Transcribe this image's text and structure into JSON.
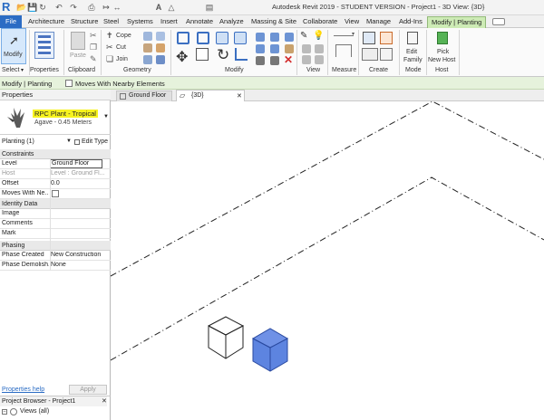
{
  "app": {
    "title": "Autodesk Revit 2019 - STUDENT VERSION - Project1 - 3D View: {3D}",
    "logo_letter": "R"
  },
  "tabs": [
    "File",
    "Architecture",
    "Structure",
    "Steel",
    "Systems",
    "Insert",
    "Annotate",
    "Analyze",
    "Massing & Site",
    "Collaborate",
    "View",
    "Manage",
    "Add-Ins",
    "Modify | Planting"
  ],
  "ribbon": {
    "modify_label": "Modify",
    "panels": {
      "select": "Select",
      "properties": "Properties",
      "clipboard": "Clipboard",
      "geometry": "Geometry",
      "modify": "Modify",
      "view": "View",
      "measure": "Measure",
      "create": "Create",
      "mode": "Mode",
      "host": "Host"
    },
    "clipboard": {
      "paste": "Paste"
    },
    "geometry": {
      "cope": "Cope",
      "cut": "Cut",
      "join": "Join"
    },
    "mode": {
      "edit_family_1": "Edit",
      "edit_family_2": "Family"
    },
    "host": {
      "pick_1": "Pick",
      "pick_2": "New Host"
    }
  },
  "context_bar": {
    "label": "Modify | Planting",
    "checkbox_label": "Moves With Nearby Elements"
  },
  "properties": {
    "header": "Properties",
    "type_name": "RPC Plant - Tropical",
    "type_sub": "Agave - 0.45 Meters",
    "instance_filter": "Planting (1)",
    "edit_type": "Edit Type",
    "groups": {
      "constraints": "Constraints",
      "identity": "Identity Data",
      "phasing": "Phasing"
    },
    "rows": {
      "level": {
        "name": "Level",
        "value": "Ground Floor"
      },
      "host": {
        "name": "Host",
        "value": "Level : Ground Fl..."
      },
      "offset": {
        "name": "Offset",
        "value": "0.0"
      },
      "moves": {
        "name": "Moves With Ne..."
      },
      "image": {
        "name": "Image"
      },
      "comments": {
        "name": "Comments"
      },
      "mark": {
        "name": "Mark"
      },
      "phase_created": {
        "name": "Phase Created",
        "value": "New Construction"
      },
      "phase_demolished": {
        "name": "Phase Demolish...",
        "value": "None"
      }
    },
    "help_link": "Properties help",
    "apply": "Apply"
  },
  "project_browser": {
    "title": "Project Browser - Project1",
    "views_node": "Views (all)"
  },
  "view_tabs": [
    {
      "label": "Ground Floor"
    },
    {
      "label": "{3D}"
    }
  ],
  "colors": {
    "accent_blue": "#2b6cc4",
    "active_tab_green": "#cdebb5",
    "type_highlight": "#f7f31f",
    "selected_cube": "#5d84e0"
  }
}
